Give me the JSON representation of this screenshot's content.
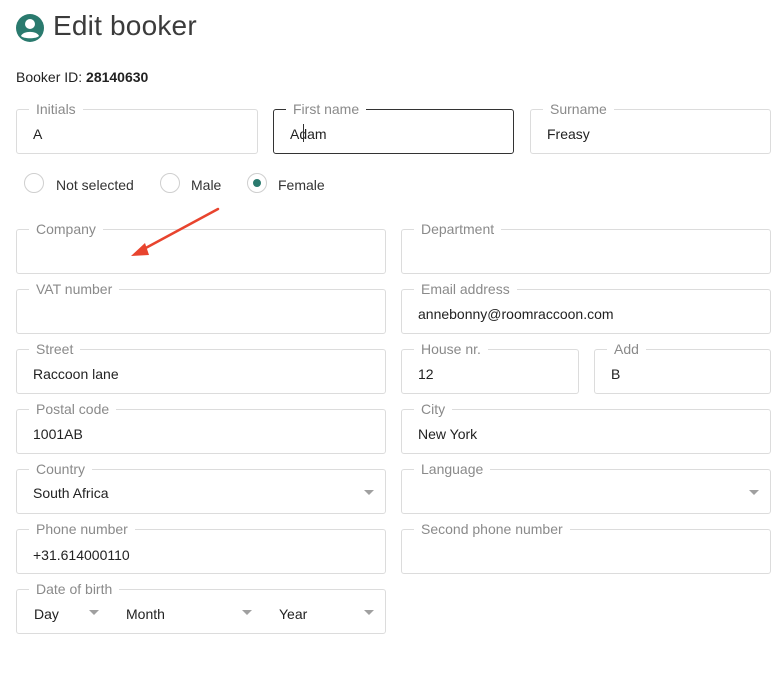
{
  "page": {
    "title": "Edit booker"
  },
  "booker": {
    "id_label": "Booker ID:",
    "id_value": "28140630"
  },
  "fields": {
    "initials": {
      "label": "Initials",
      "value": "A"
    },
    "first_name": {
      "label": "First name",
      "value": "Adam"
    },
    "surname": {
      "label": "Surname",
      "value": "Freasy"
    },
    "company": {
      "label": "Company",
      "value": ""
    },
    "department": {
      "label": "Department",
      "value": ""
    },
    "vat_number": {
      "label": "VAT number",
      "value": ""
    },
    "email": {
      "label": "Email address",
      "value": "annebonny@roomraccoon.com"
    },
    "street": {
      "label": "Street",
      "value": "Raccoon lane"
    },
    "house_nr": {
      "label": "House nr.",
      "value": "12"
    },
    "add": {
      "label": "Add",
      "value": "B"
    },
    "postal_code": {
      "label": "Postal code",
      "value": "1001AB"
    },
    "city": {
      "label": "City",
      "value": "New York"
    },
    "country": {
      "label": "Country",
      "value": "South Africa"
    },
    "language": {
      "label": "Language",
      "value": ""
    },
    "phone": {
      "label": "Phone number",
      "value": "+31.614000110"
    },
    "second_phone": {
      "label": "Second phone number",
      "value": ""
    },
    "dob": {
      "label": "Date of birth",
      "day": "Day",
      "month": "Month",
      "year": "Year"
    }
  },
  "gender": {
    "options": [
      "Not selected",
      "Male",
      "Female"
    ],
    "selected": "Female"
  },
  "colors": {
    "accent": "#2a7a6e",
    "annotation_arrow": "#e8442e"
  },
  "icons": {
    "title_icon": "user-circle-icon",
    "annotation": "arrow-annotation"
  }
}
